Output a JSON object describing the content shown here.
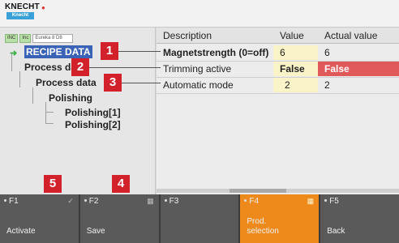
{
  "brand": {
    "name": "KNECHT",
    "badge": "Knecht"
  },
  "toolbar": {
    "btn_a": "INC",
    "btn_b": "Inc",
    "field_value": "Eureka 8 D8"
  },
  "tree": [
    {
      "label": "RECIPE DATA",
      "selected": true
    },
    {
      "label": "Process data"
    },
    {
      "label": "Process data"
    },
    {
      "label": "Polishing"
    },
    {
      "label": "Polishing[1]"
    },
    {
      "label": "Polishing[2]"
    }
  ],
  "table": {
    "headers": [
      "Description",
      "Value",
      "Actual value"
    ],
    "rows": [
      {
        "description": "Magnetstrength (0=off)",
        "value": "6",
        "actual": "6"
      },
      {
        "description": "Trimming active",
        "value": "False",
        "actual": "False"
      },
      {
        "description": "Automatic mode",
        "value": "2",
        "actual": "2"
      }
    ]
  },
  "markers": [
    "1",
    "2",
    "3",
    "4",
    "5"
  ],
  "fkeys": [
    {
      "key": "F1",
      "label": "Activate"
    },
    {
      "key": "F2",
      "label": "Save"
    },
    {
      "key": "F3",
      "label": ""
    },
    {
      "key": "F4",
      "label": "Prod.\nselection",
      "active": true
    },
    {
      "key": "F5",
      "label": "Back"
    }
  ],
  "colors": {
    "selection": "#3a63b5",
    "accent": "#ee8a1c",
    "marker": "#d3212c",
    "alarm": "#e05a5a",
    "value_bg": "#fbf3c8"
  }
}
